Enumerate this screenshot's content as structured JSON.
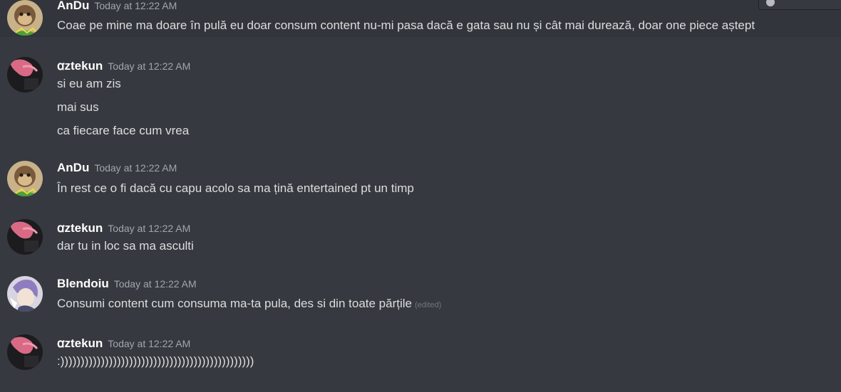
{
  "messages": [
    {
      "username": "AnDu",
      "timestamp": "Today at 12:22 AM",
      "avatar": "monkey-avatar",
      "lines": [
        "Coae pe mine ma doare în pulă eu doar consum content nu-mi pasa dacă e gata sau nu și cât mai durează, doar one piece aștept"
      ]
    },
    {
      "username": "ꭤztekun",
      "timestamp": "Today at 12:22 AM",
      "avatar": "pink-hair-avatar",
      "lines": [
        "si eu am zis",
        "mai sus",
        "ca fiecare face cum vrea"
      ]
    },
    {
      "username": "AnDu",
      "timestamp": "Today at 12:22 AM",
      "avatar": "monkey-avatar",
      "lines": [
        "În rest ce o fi dacă cu capu acolo sa ma țină entertained pt un timp"
      ]
    },
    {
      "username": "ꭤztekun",
      "timestamp": "Today at 12:22 AM",
      "avatar": "pink-hair-avatar",
      "lines": [
        "dar tu in loc sa ma asculti"
      ]
    },
    {
      "username": "Blendoiu",
      "timestamp": "Today at 12:22 AM",
      "avatar": "anime-character-avatar",
      "lines": [
        "Consumi content cum consuma ma-ta pula, des si din toate părțile"
      ],
      "edited": "(edited)"
    },
    {
      "username": "ꭤztekun",
      "timestamp": "Today at 12:22 AM",
      "avatar": "pink-hair-avatar",
      "lines": [
        ":))))))))))))))))))))))))))))))))))))))))))))))))"
      ]
    }
  ],
  "colors": {
    "background": "#36393f",
    "username": "#ffffff",
    "timestamp": "#a3a6aa",
    "message_text": "#dcddde",
    "edited_text": "#72767d"
  }
}
